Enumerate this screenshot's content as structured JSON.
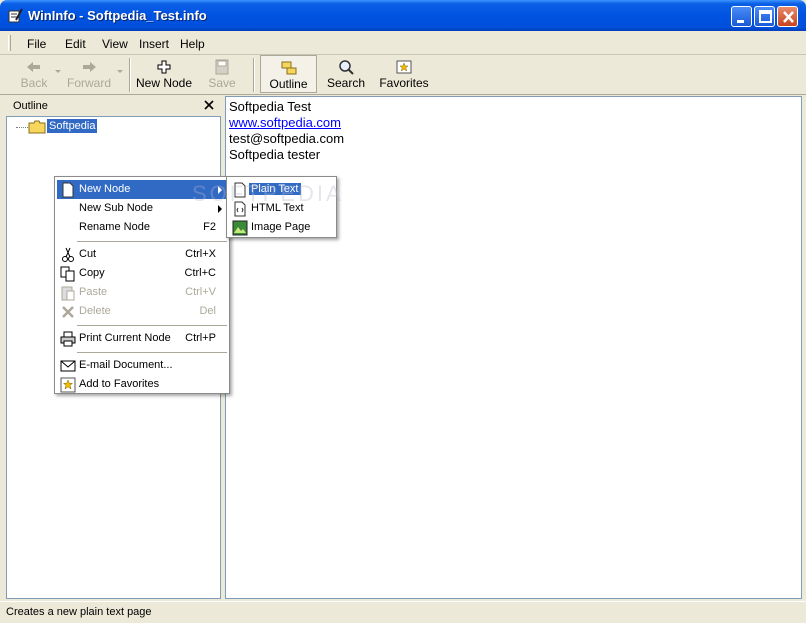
{
  "window": {
    "title": "WinInfo - Softpedia_Test.info"
  },
  "menubar": {
    "items": [
      {
        "label": "File"
      },
      {
        "label": "Edit"
      },
      {
        "label": "View"
      },
      {
        "label": "Insert"
      },
      {
        "label": "Help"
      }
    ]
  },
  "toolbar": {
    "back": "Back",
    "forward": "Forward",
    "new_node": "New Node",
    "save": "Save",
    "outline": "Outline",
    "search": "Search",
    "favorites": "Favorites"
  },
  "outline": {
    "header": "Outline",
    "root_node": "Softpedia"
  },
  "content": {
    "lines": [
      "Softpedia Test",
      "www.softpedia.com",
      "test@softpedia.com",
      "Softpedia tester"
    ]
  },
  "context_menu": {
    "new_node": "New Node",
    "new_sub_node": "New Sub Node",
    "rename_node": "Rename Node",
    "rename_shortcut": "F2",
    "cut": "Cut",
    "cut_shortcut": "Ctrl+X",
    "copy": "Copy",
    "copy_shortcut": "Ctrl+C",
    "paste": "Paste",
    "paste_shortcut": "Ctrl+V",
    "delete": "Delete",
    "delete_shortcut": "Del",
    "print": "Print Current Node",
    "print_shortcut": "Ctrl+P",
    "email": "E-mail Document...",
    "favorites": "Add to Favorites"
  },
  "submenu": {
    "plain_text": "Plain Text",
    "html_text": "HTML Text",
    "image_page": "Image Page"
  },
  "statusbar": {
    "text": "Creates a new plain text page"
  },
  "watermark": "SOFTPEDIA",
  "colors": {
    "titlebar": "#0053e1",
    "selection": "#316ac5",
    "link": "#0000ff",
    "face": "#ece9d8"
  }
}
